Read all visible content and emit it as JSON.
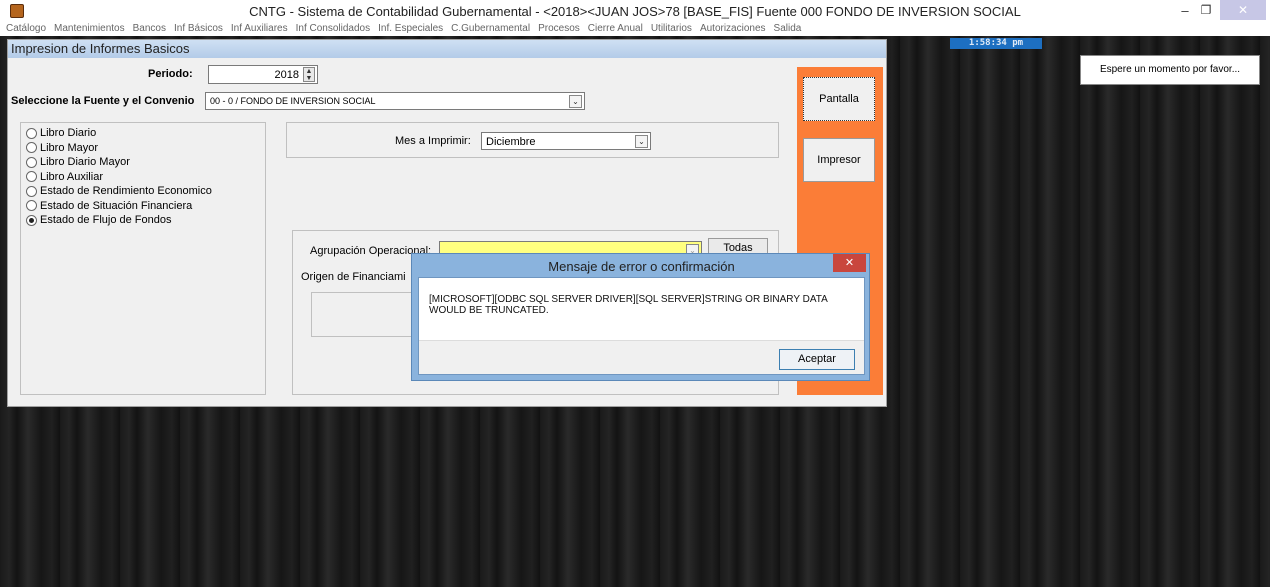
{
  "window": {
    "title": "CNTG - Sistema de Contabilidad Gubernamental - <2018><JUAN JOS>78 [BASE_FIS] Fuente 000 FONDO DE INVERSION SOCIAL",
    "minimize": "‒",
    "maximize": "❐",
    "close": "✕"
  },
  "menu": [
    "Catálogo",
    "Mantenimientos",
    "Bancos",
    "Inf Básicos",
    "Inf Auxiliares",
    "Inf Consolidados",
    "Inf. Especiales",
    "C.Gubernamental",
    "Procesos",
    "Cierre Anual",
    "Utilitarios",
    "Autorizaciones",
    "Salida"
  ],
  "clock": "1:58:34 pm",
  "wait_message": "Espere un momento por favor...",
  "form": {
    "header": "Impresion de Informes Basicos",
    "periodo_label": "Periodo:",
    "periodo_value": "2018",
    "fuente_label": "Seleccione la Fuente y el Convenio",
    "fuente_value": "00 - 0 / FONDO DE INVERSION SOCIAL",
    "reports": [
      {
        "label": "Libro Diario",
        "selected": false
      },
      {
        "label": "Libro Mayor",
        "selected": false
      },
      {
        "label": "Libro Diario Mayor",
        "selected": false
      },
      {
        "label": "Libro Auxiliar",
        "selected": false
      },
      {
        "label": "Estado de Rendimiento Economico",
        "selected": false
      },
      {
        "label": "Estado de Situación Financiera",
        "selected": false
      },
      {
        "label": "Estado de Flujo de Fondos",
        "selected": true
      }
    ],
    "mes_label": "Mes a Imprimir:",
    "mes_value": "Diciembre",
    "agrupacion_label": "Agrupación Operacional:",
    "agrupacion_value": "",
    "todas_label": "Todas",
    "origen_label": "Origen de Financiami",
    "pantalla_label": "Pantalla",
    "impresor_label": "Impresor"
  },
  "dialog": {
    "title": "Mensaje de error o confirmación",
    "close": "✕",
    "message": "[MICROSOFT][ODBC SQL SERVER DRIVER][SQL SERVER]STRING OR BINARY DATA WOULD BE TRUNCATED.",
    "ok_label": "Aceptar"
  },
  "colors": {
    "orange_panel": "#fb7d37",
    "dialog_frame": "#8ab3dd",
    "agrupacion_field": "#ffff80",
    "clock_bg": "#1d6fc1"
  }
}
